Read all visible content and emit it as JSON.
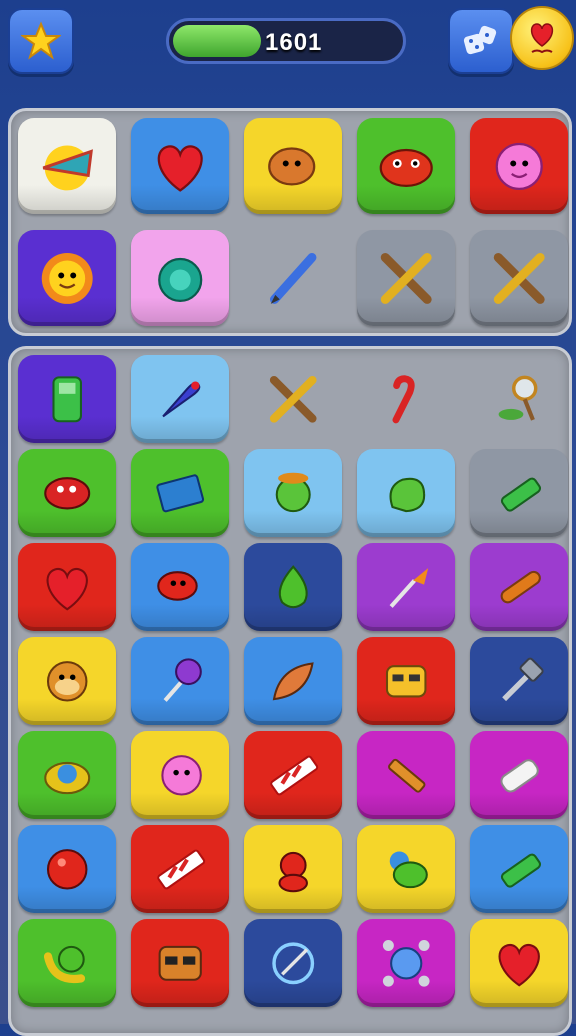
{
  "hud": {
    "score": "1601",
    "progress_fraction": 0.38,
    "star_icon": "star-icon",
    "dice_icon": "dice-icon",
    "avatar_icon": "heart-face-icon"
  },
  "colors": {
    "white": "#f1f1ea",
    "blue": "#3f8fe6",
    "yellow": "#f5d62a",
    "green": "#4ec02c",
    "red": "#e0261c",
    "purple": "#5a2fd1",
    "pink": "#f2a4ec",
    "gray": "#8f97a4",
    "lightblue": "#7fc4f0",
    "magenta": "#c726c4",
    "violet": "#9c3ccf",
    "navy": "#2c4a9c",
    "orange": "#e85a1c"
  },
  "top_tiles": [
    {
      "icon": "cone-sun-icon",
      "bg": "white"
    },
    {
      "icon": "heart-icon",
      "bg": "blue"
    },
    {
      "icon": "bean-creature-icon",
      "bg": "yellow"
    },
    {
      "icon": "red-fish-icon",
      "bg": "green"
    },
    {
      "icon": "pink-blob-icon",
      "bg": "red"
    },
    {
      "icon": "sun-face-icon",
      "bg": "purple"
    },
    {
      "icon": "turtle-icon",
      "bg": "pink"
    },
    {
      "icon": "pencil-icon",
      "bg": "none"
    },
    {
      "icon": "crossed-pencil-icon",
      "bg": "gray"
    },
    {
      "icon": "crossed-pencil-icon",
      "bg": "gray"
    }
  ],
  "bottom_tiles": [
    {
      "icon": "walkie-talkie-icon",
      "bg": "purple"
    },
    {
      "icon": "rocket-icon",
      "bg": "lightblue"
    },
    {
      "icon": "crossed-pencil-icon",
      "bg": "none"
    },
    {
      "icon": "cane-icon",
      "bg": "none"
    },
    {
      "icon": "magnifier-leaf-icon",
      "bg": "none"
    },
    {
      "icon": "red-bug-icon",
      "bg": "green"
    },
    {
      "icon": "book-icon",
      "bg": "green"
    },
    {
      "icon": "green-frog-icon",
      "bg": "lightblue"
    },
    {
      "icon": "green-blob-icon",
      "bg": "lightblue"
    },
    {
      "icon": "green-tube-icon",
      "bg": "gray"
    },
    {
      "icon": "heart-icon",
      "bg": "red"
    },
    {
      "icon": "red-bean-icon",
      "bg": "blue"
    },
    {
      "icon": "green-drop-icon",
      "bg": "navy"
    },
    {
      "icon": "leaf-wand-icon",
      "bg": "violet"
    },
    {
      "icon": "sausage-icon",
      "bg": "violet"
    },
    {
      "icon": "monkey-face-icon",
      "bg": "yellow"
    },
    {
      "icon": "lollipop-icon",
      "bg": "blue"
    },
    {
      "icon": "feather-icon",
      "bg": "blue"
    },
    {
      "icon": "robot-face-icon",
      "bg": "red"
    },
    {
      "icon": "hammer-icon",
      "bg": "navy"
    },
    {
      "icon": "blue-gem-icon",
      "bg": "green"
    },
    {
      "icon": "pink-ball-icon",
      "bg": "yellow"
    },
    {
      "icon": "candy-stick-icon",
      "bg": "red"
    },
    {
      "icon": "pencil-stub-icon",
      "bg": "magenta"
    },
    {
      "icon": "eraser-icon",
      "bg": "magenta"
    },
    {
      "icon": "red-ball-icon",
      "bg": "blue"
    },
    {
      "icon": "candy-stick-icon",
      "bg": "red"
    },
    {
      "icon": "red-teddy-icon",
      "bg": "yellow"
    },
    {
      "icon": "green-gourd-icon",
      "bg": "yellow"
    },
    {
      "icon": "green-tube-icon",
      "bg": "blue"
    },
    {
      "icon": "banana-orb-icon",
      "bg": "green"
    },
    {
      "icon": "sunglasses-face-icon",
      "bg": "red"
    },
    {
      "icon": "compass-icon",
      "bg": "navy"
    },
    {
      "icon": "blue-robot-icon",
      "bg": "magenta"
    },
    {
      "icon": "heart-icon",
      "bg": "yellow"
    }
  ]
}
